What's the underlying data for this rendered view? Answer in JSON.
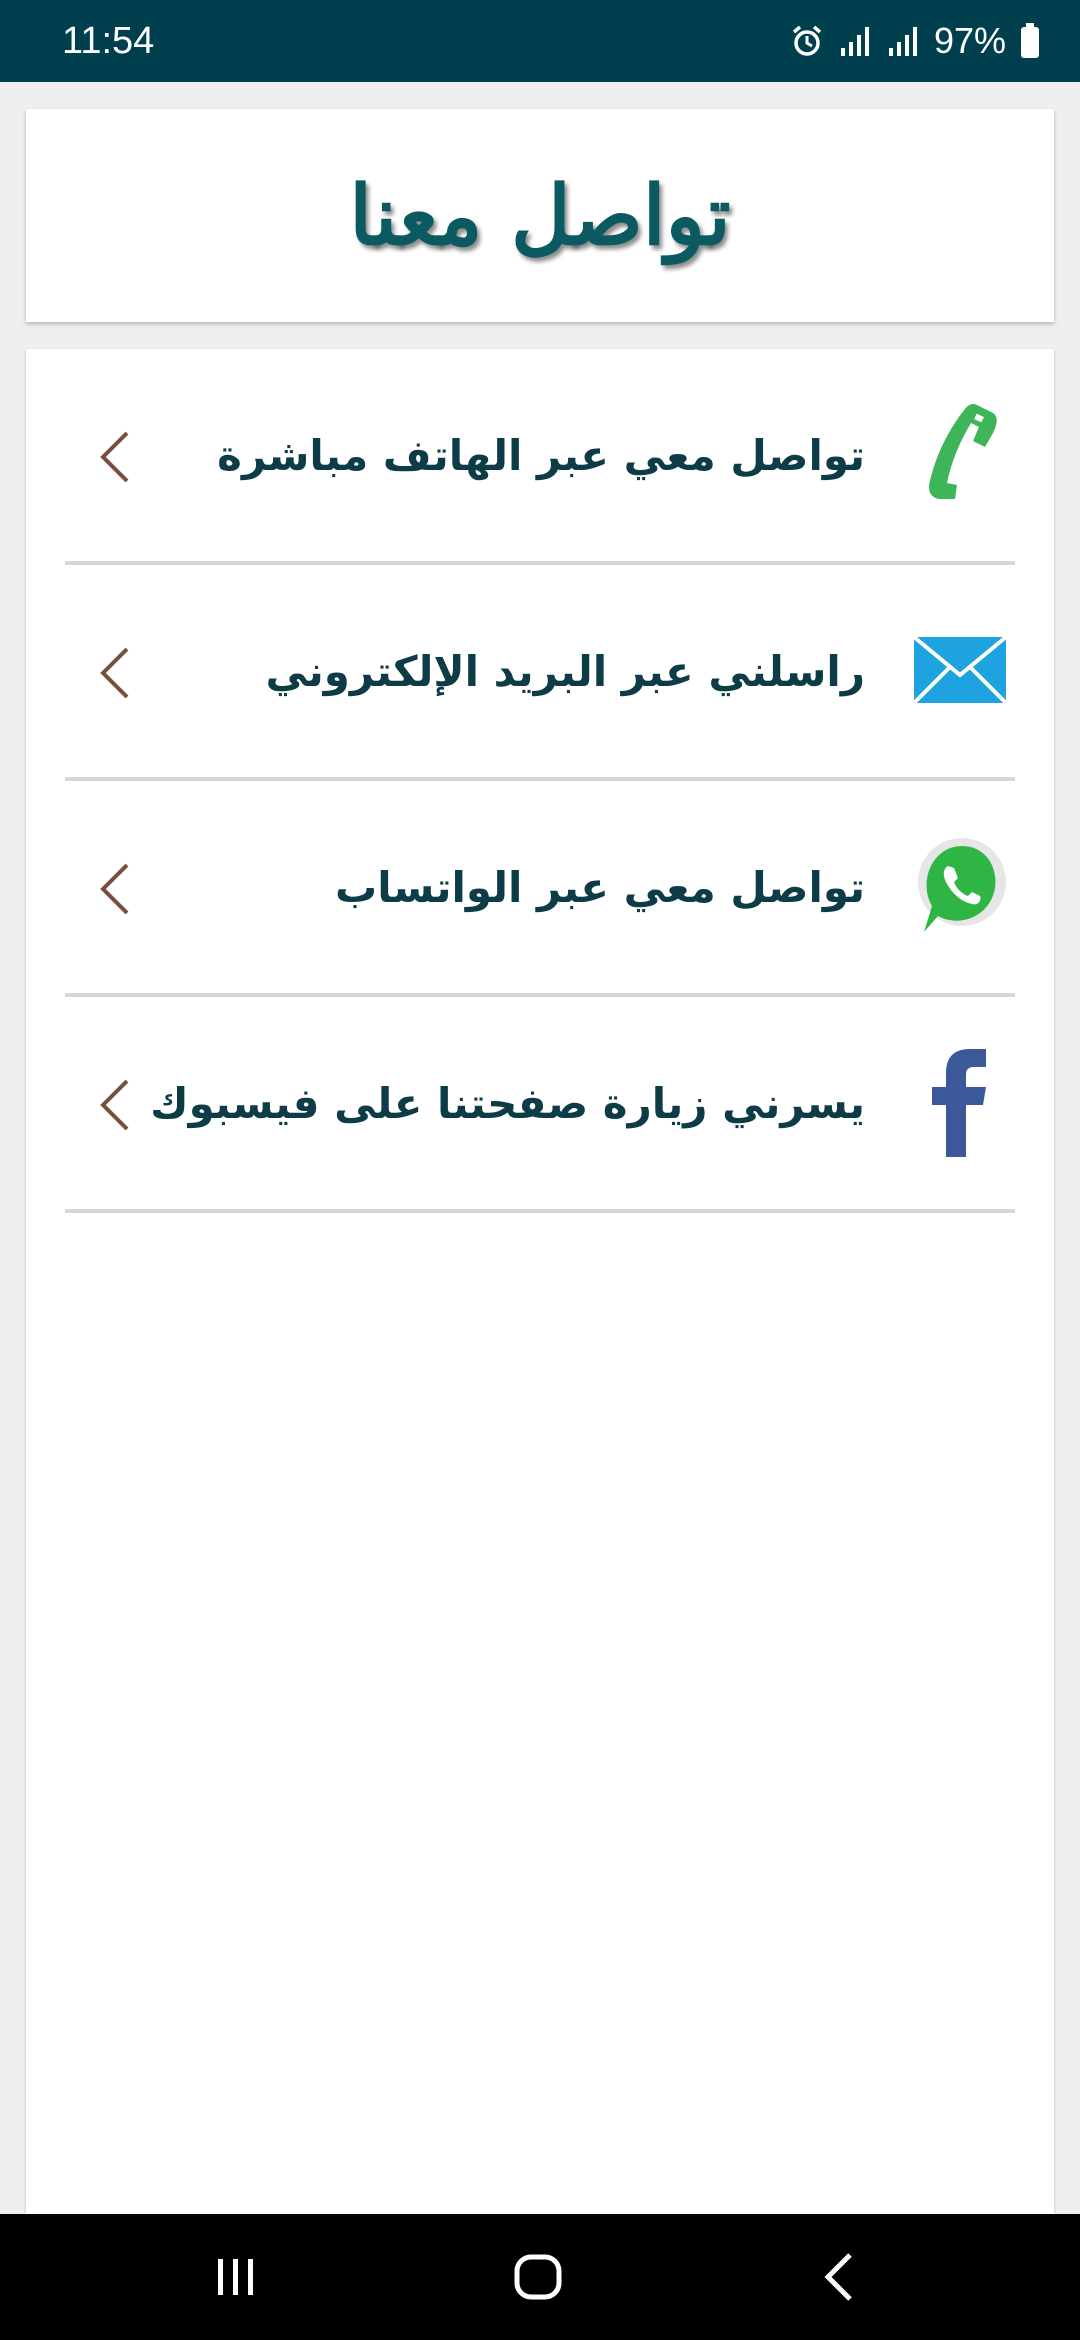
{
  "status_bar": {
    "time": "11:54",
    "battery": "97%",
    "icons": [
      "alarm-icon",
      "signal-icon",
      "signal-icon",
      "battery-icon"
    ]
  },
  "header": {
    "title": "تواصل معنا"
  },
  "contacts": [
    {
      "label": "تواصل معي عبر الهاتف مباشرة",
      "icon": "phone-icon",
      "color": "#3fb559"
    },
    {
      "label": "راسلني عبر البريد الإلكتروني",
      "icon": "mail-icon",
      "color": "#1ea3e0"
    },
    {
      "label": "تواصل معي عبر الواتساب",
      "icon": "whatsapp-icon",
      "color": "#2fb544"
    },
    {
      "label": "يسرني زيارة صفحتنا على فيسبوك",
      "icon": "facebook-icon",
      "color": "#3b5998"
    }
  ],
  "colors": {
    "status_bar_bg": "#003f4d",
    "title_color": "#0b5a62",
    "label_color": "#0d3b46",
    "chevron_color": "#7a4f3c",
    "divider": "#d6d6d6"
  },
  "nav_bar": {
    "buttons": [
      "recents-icon",
      "home-icon",
      "back-icon"
    ]
  }
}
